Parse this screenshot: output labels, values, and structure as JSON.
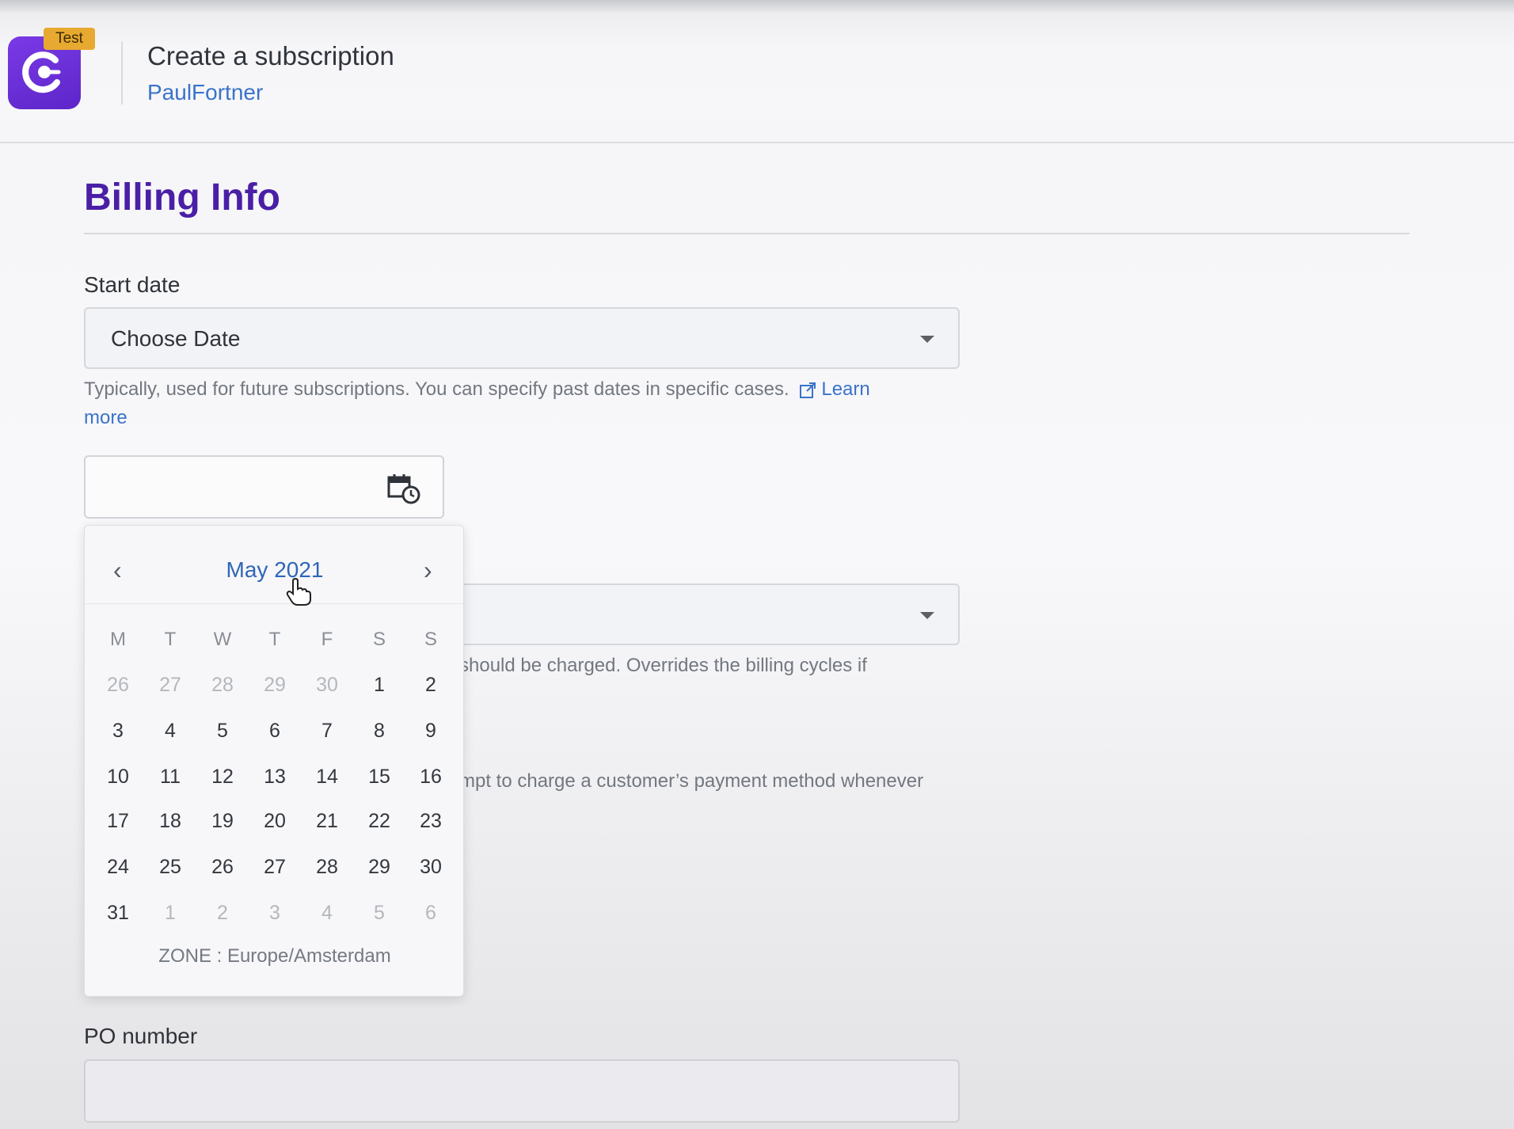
{
  "header": {
    "badge": "Test",
    "title": "Create a subscription",
    "account": "PaulFortner",
    "brand_color": "#6a2fd8"
  },
  "billing": {
    "section_title": "Billing Info",
    "start_date": {
      "label": "Start date",
      "value": "Choose Date",
      "help_text": "Typically, used for future subscriptions. You can specify past dates in specific cases.",
      "learn_more": "Learn",
      "learn_more_2": "more"
    },
    "date_input": {
      "value": "",
      "icon": "calendar-clock-icon"
    },
    "hidden_select": {
      "help_partial": "should be charged. Overrides the billing cycles if"
    },
    "hidden_help_2": "mpt to charge a customer’s payment method whenever",
    "po_number": {
      "label": "PO number",
      "value": ""
    }
  },
  "calendar": {
    "month_label": "May 2021",
    "prev": "‹",
    "next": "›",
    "weekdays": [
      "M",
      "T",
      "W",
      "T",
      "F",
      "S",
      "S"
    ],
    "weeks": [
      [
        {
          "d": "26",
          "m": true
        },
        {
          "d": "27",
          "m": true
        },
        {
          "d": "28",
          "m": true
        },
        {
          "d": "29",
          "m": true
        },
        {
          "d": "30",
          "m": true
        },
        {
          "d": "1",
          "m": false
        },
        {
          "d": "2",
          "m": false
        }
      ],
      [
        {
          "d": "3",
          "m": false
        },
        {
          "d": "4",
          "m": false
        },
        {
          "d": "5",
          "m": false
        },
        {
          "d": "6",
          "m": false
        },
        {
          "d": "7",
          "m": false
        },
        {
          "d": "8",
          "m": false
        },
        {
          "d": "9",
          "m": false
        }
      ],
      [
        {
          "d": "10",
          "m": false
        },
        {
          "d": "11",
          "m": false
        },
        {
          "d": "12",
          "m": false
        },
        {
          "d": "13",
          "m": false
        },
        {
          "d": "14",
          "m": false
        },
        {
          "d": "15",
          "m": false
        },
        {
          "d": "16",
          "m": false
        }
      ],
      [
        {
          "d": "17",
          "m": false
        },
        {
          "d": "18",
          "m": false
        },
        {
          "d": "19",
          "m": false
        },
        {
          "d": "20",
          "m": false
        },
        {
          "d": "21",
          "m": false
        },
        {
          "d": "22",
          "m": false
        },
        {
          "d": "23",
          "m": false
        }
      ],
      [
        {
          "d": "24",
          "m": false
        },
        {
          "d": "25",
          "m": false
        },
        {
          "d": "26",
          "m": false
        },
        {
          "d": "27",
          "m": false
        },
        {
          "d": "28",
          "m": false
        },
        {
          "d": "29",
          "m": false
        },
        {
          "d": "30",
          "m": false
        }
      ],
      [
        {
          "d": "31",
          "m": false
        },
        {
          "d": "1",
          "m": true
        },
        {
          "d": "2",
          "m": true
        },
        {
          "d": "3",
          "m": true
        },
        {
          "d": "4",
          "m": true
        },
        {
          "d": "5",
          "m": true
        },
        {
          "d": "6",
          "m": true
        }
      ]
    ],
    "zone": "ZONE : Europe/Amsterdam"
  }
}
